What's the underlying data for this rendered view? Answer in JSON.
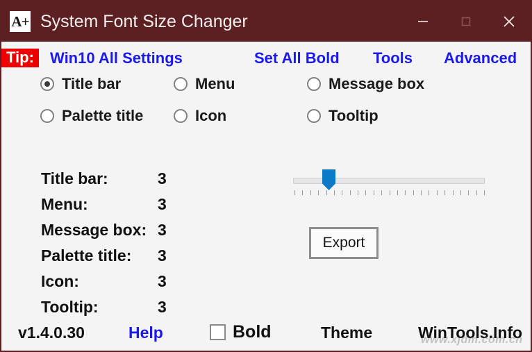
{
  "window": {
    "icon_glyph": "A+",
    "title": "System Font Size Changer",
    "titlebar_color": "#5c2023",
    "controls": {
      "minimize": "–",
      "maximize": "□",
      "close": "✕"
    }
  },
  "menu": {
    "tip_label": "Tip:",
    "tip_bg": "#ee0000",
    "link_color": "#1a1aee",
    "items": [
      {
        "label": "Win10 All Settings"
      },
      {
        "label": "Set All Bold"
      },
      {
        "label": "Tools"
      },
      {
        "label": "Advanced"
      }
    ]
  },
  "radio_group": {
    "selected": "Title bar",
    "options": [
      {
        "label": "Title bar",
        "checked": true
      },
      {
        "label": "Menu",
        "checked": false
      },
      {
        "label": "Message box",
        "checked": false
      },
      {
        "label": "Palette title",
        "checked": false
      },
      {
        "label": "Icon",
        "checked": false
      },
      {
        "label": "Tooltip",
        "checked": false
      }
    ]
  },
  "values": [
    {
      "name": "Title bar:",
      "value": "3"
    },
    {
      "name": "Menu:",
      "value": "3"
    },
    {
      "name": "Message box:",
      "value": "3"
    },
    {
      "name": "Palette title:",
      "value": "3"
    },
    {
      "name": "Icon:",
      "value": "3"
    },
    {
      "name": "Tooltip:",
      "value": "3"
    }
  ],
  "slider": {
    "value": 3,
    "min": 0,
    "max": 25,
    "tick_count": 25,
    "thumb_color": "#0d7ac8"
  },
  "export": {
    "label": "Export"
  },
  "footer": {
    "version": "v1.4.0.30",
    "help": "Help",
    "bold_label": "Bold",
    "bold_checked": false,
    "theme": "Theme",
    "site": "WinTools.Info",
    "watermark": "www.xjdm.com.cn"
  }
}
